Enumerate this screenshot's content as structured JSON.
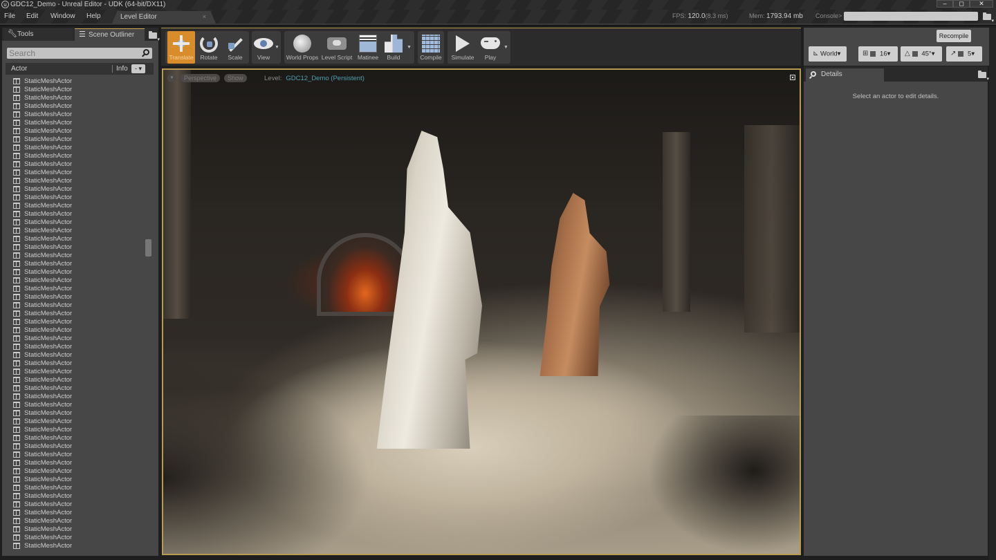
{
  "window": {
    "title": "GDC12_Demo - Unreal Editor - UDK (64-bit/DX11)",
    "logo_glyph": "u",
    "controls": {
      "minimize": "–",
      "maximize": "◻",
      "close": "✕"
    }
  },
  "menu": [
    "File",
    "Edit",
    "Window",
    "Help"
  ],
  "document_tab": {
    "label": "Level Editor",
    "close": "×"
  },
  "stats": {
    "fps_label": "FPS:",
    "fps_value": "120.0",
    "fps_ms": "(8.3 ms)",
    "mem_label": "Mem:",
    "mem_value": "1793.94 mb",
    "console_label": "Console>",
    "console_value": ""
  },
  "left_panel": {
    "tabs": [
      {
        "label": "Tools",
        "icon": "wrench-icon",
        "active": false
      },
      {
        "label": "Scene Outliner",
        "icon": "list-icon",
        "active": true
      }
    ],
    "search_placeholder": "Search",
    "columns": {
      "actor": "Actor",
      "info": "Info",
      "info_dropdown": "- ▾"
    },
    "actors": [
      "StaticMeshActor",
      "StaticMeshActor",
      "StaticMeshActor",
      "StaticMeshActor",
      "StaticMeshActor",
      "StaticMeshActor",
      "StaticMeshActor",
      "StaticMeshActor",
      "StaticMeshActor",
      "StaticMeshActor",
      "StaticMeshActor",
      "StaticMeshActor",
      "StaticMeshActor",
      "StaticMeshActor",
      "StaticMeshActor",
      "StaticMeshActor",
      "StaticMeshActor",
      "StaticMeshActor",
      "StaticMeshActor",
      "StaticMeshActor",
      "StaticMeshActor",
      "StaticMeshActor",
      "StaticMeshActor",
      "StaticMeshActor",
      "StaticMeshActor",
      "StaticMeshActor",
      "StaticMeshActor",
      "StaticMeshActor",
      "StaticMeshActor",
      "StaticMeshActor",
      "StaticMeshActor",
      "StaticMeshActor",
      "StaticMeshActor",
      "StaticMeshActor",
      "StaticMeshActor",
      "StaticMeshActor",
      "StaticMeshActor",
      "StaticMeshActor",
      "StaticMeshActor",
      "StaticMeshActor",
      "StaticMeshActor",
      "StaticMeshActor",
      "StaticMeshActor",
      "StaticMeshActor",
      "StaticMeshActor",
      "StaticMeshActor",
      "StaticMeshActor",
      "StaticMeshActor",
      "StaticMeshActor",
      "StaticMeshActor",
      "StaticMeshActor",
      "StaticMeshActor",
      "StaticMeshActor",
      "StaticMeshActor",
      "StaticMeshActor",
      "StaticMeshActor",
      "StaticMeshActor"
    ]
  },
  "toolbar": {
    "transform": [
      {
        "label": "Translate",
        "icon": "translate-icon",
        "active": true
      },
      {
        "label": "Rotate",
        "icon": "rotate-icon",
        "active": false
      },
      {
        "label": "Scale",
        "icon": "scale-icon",
        "active": false
      }
    ],
    "view": {
      "label": "View",
      "icon": "eye-icon"
    },
    "level": [
      {
        "label": "World Props",
        "icon": "globe-icon"
      },
      {
        "label": "Level Script",
        "icon": "gamepad-script-icon"
      },
      {
        "label": "Matinee",
        "icon": "clapperboard-icon"
      },
      {
        "label": "Build",
        "icon": "build-blocks-icon"
      }
    ],
    "compile": {
      "label": "Compile",
      "icon": "cube-grid-icon"
    },
    "play": [
      {
        "label": "Simulate",
        "icon": "play-triangle-icon"
      },
      {
        "label": "Play",
        "icon": "gamepad-icon"
      }
    ],
    "recompile_label": "Recompile"
  },
  "snap_controls": {
    "coord_space": "World",
    "grid_snap": "16",
    "rotation_snap": "45°",
    "scale_snap": "5"
  },
  "viewport": {
    "menu_glyph": "▾",
    "perspective_label": "Perspective",
    "show_label": "Show",
    "level_label": "Level:",
    "level_value": "GDC12_Demo (Persistent)"
  },
  "details": {
    "tab_label": "Details",
    "empty_message": "Select an actor to edit details."
  },
  "colors": {
    "accent_orange": "#d98d2a",
    "viewport_border": "#b89a52",
    "level_name": "#4e9fb0",
    "panel_bg": "#474747"
  }
}
